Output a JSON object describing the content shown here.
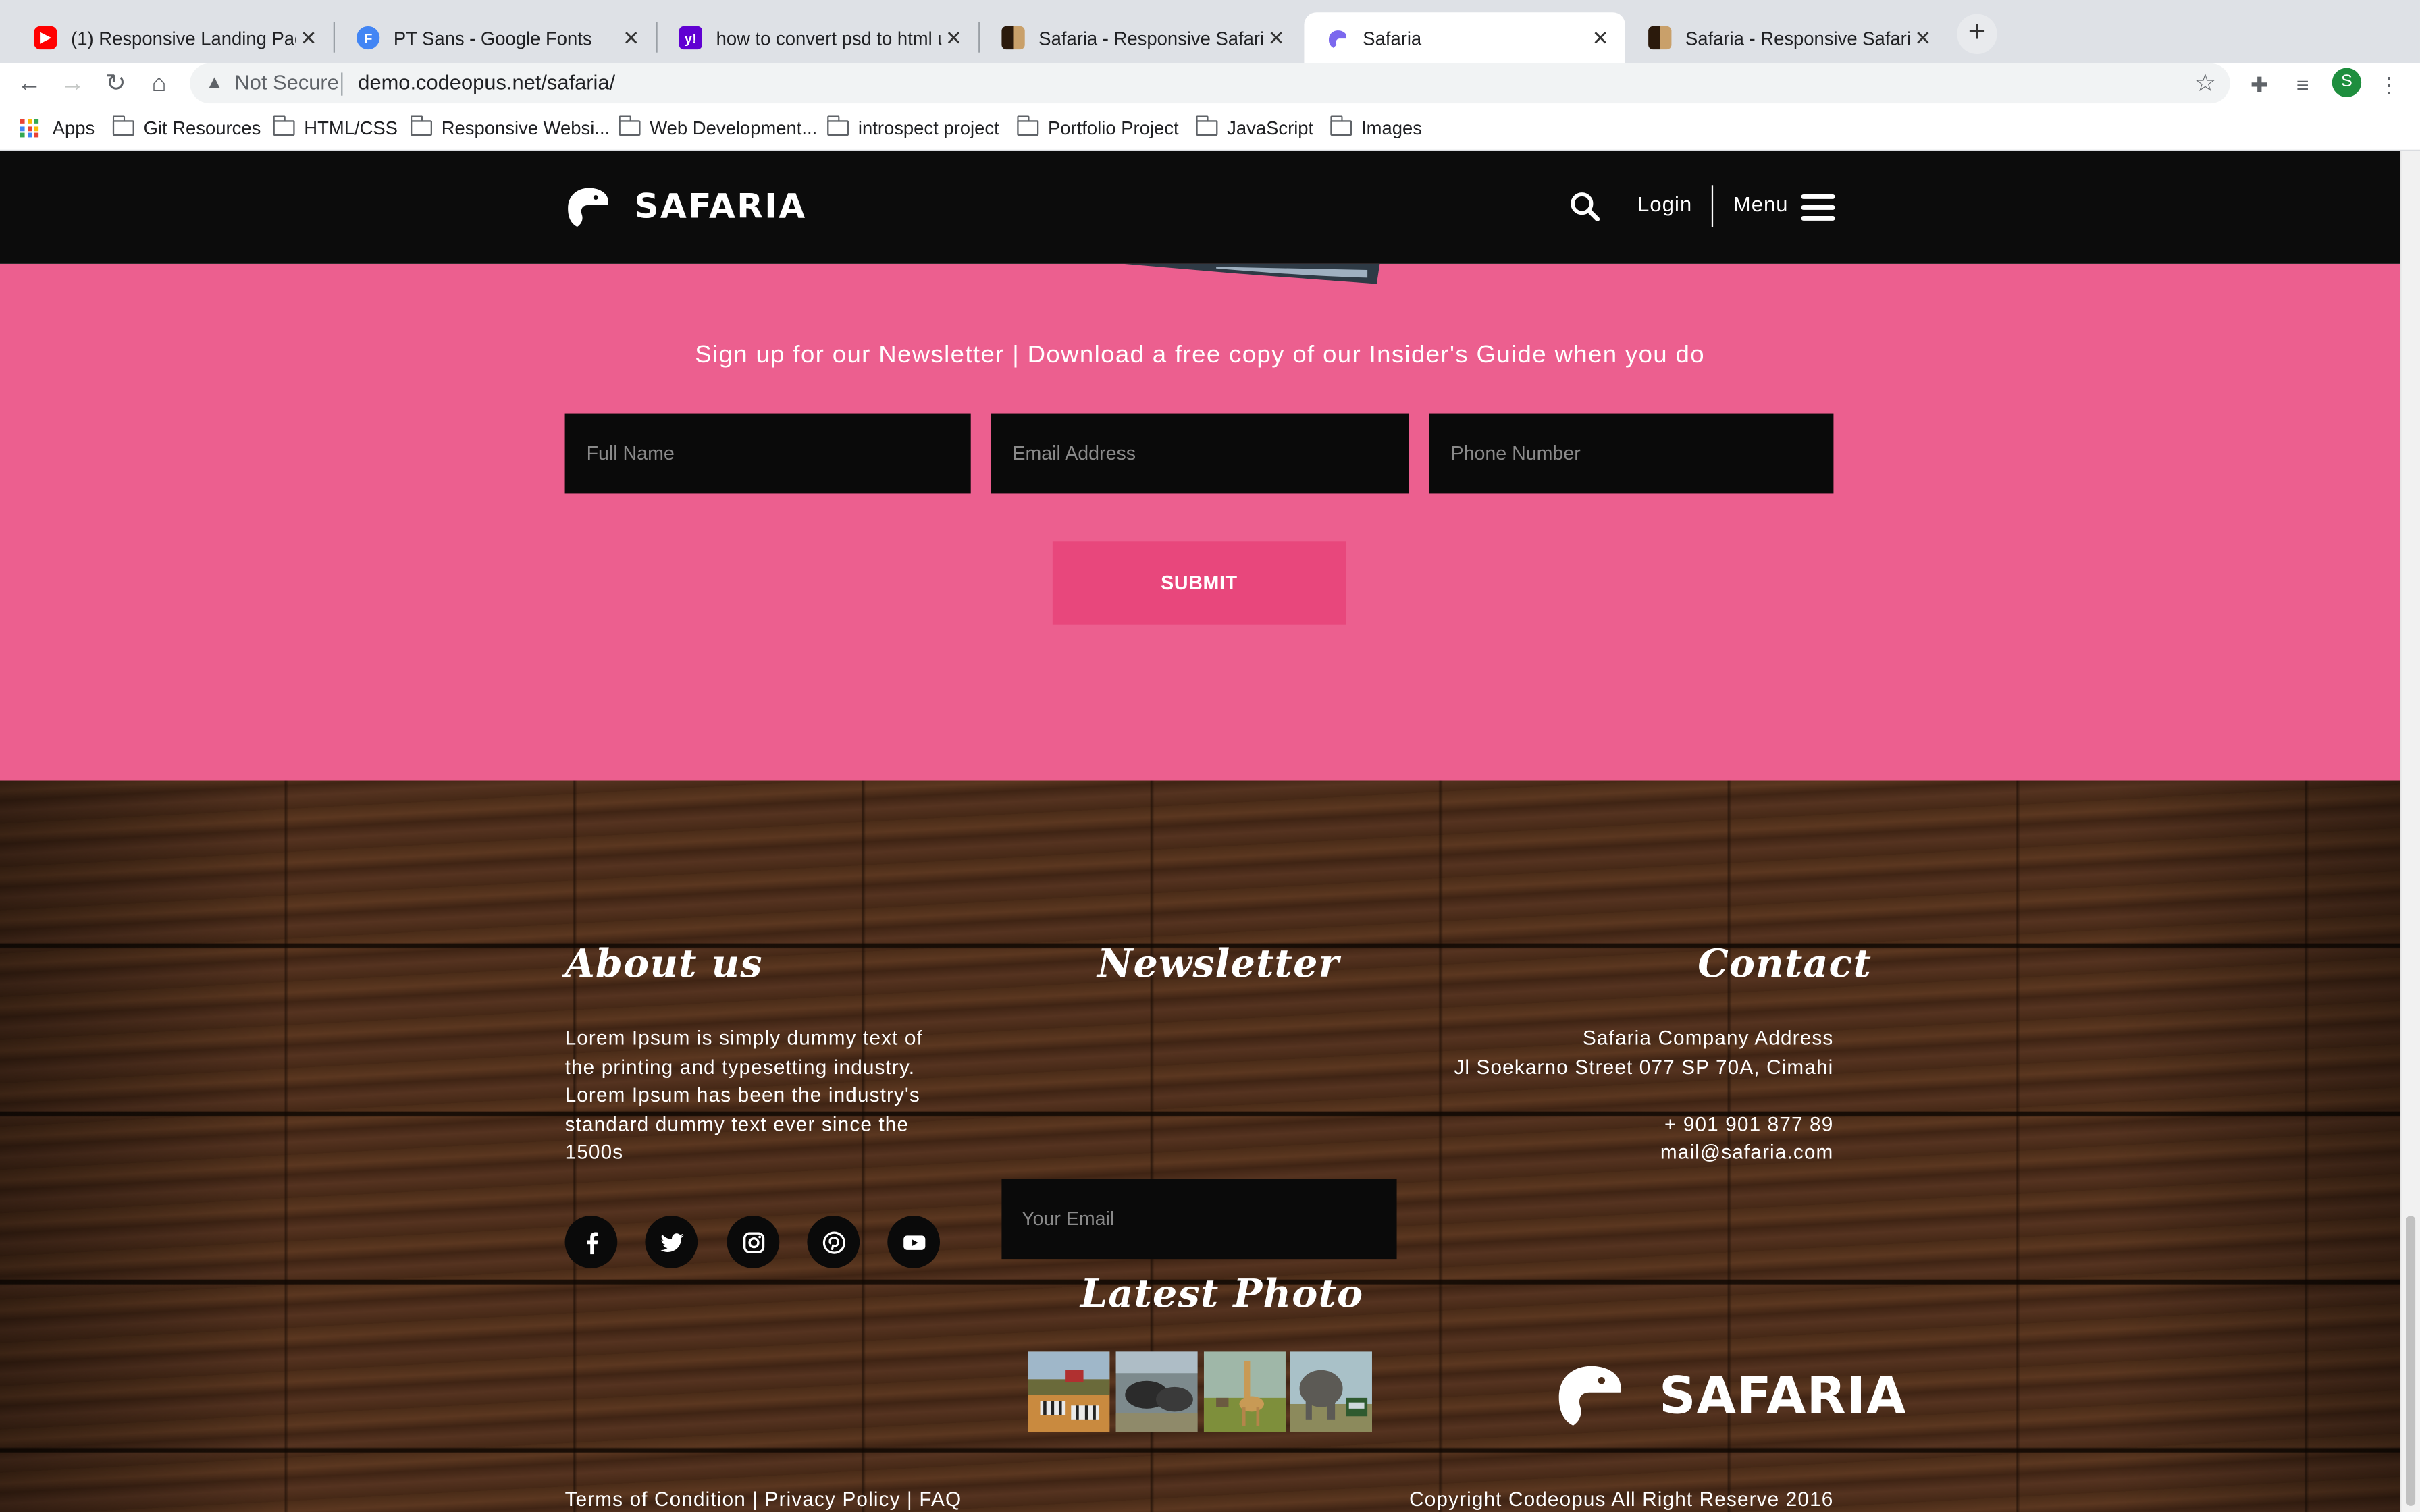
{
  "browser": {
    "tabs": [
      {
        "title": "(1) Responsive Landing Page U",
        "favicon": "youtube-icon",
        "color": "#ff0000"
      },
      {
        "title": "PT Sans - Google Fonts",
        "favicon": "google-fonts-icon",
        "color": "#4285f4"
      },
      {
        "title": "how to convert psd to html usin",
        "favicon": "yahoo-icon",
        "color": "#6001d2"
      },
      {
        "title": "Safaria - Responsive Safari Ten",
        "favicon": "safaria-thumb-icon",
        "color": "#5b3a1e"
      },
      {
        "title": "Safaria",
        "favicon": "safaria-icon",
        "color": "#7b68ee",
        "active": true
      },
      {
        "title": "Safaria - Responsive Safari Ten",
        "favicon": "safaria-thumb-icon",
        "color": "#5b3a1e"
      }
    ],
    "omnibox": {
      "security_label": "Not Secure",
      "url": "demo.codeopus.net/safaria/"
    },
    "profile_initial": "S",
    "bookmarks": [
      {
        "label": "Apps",
        "icon": "apps-grid-icon"
      },
      {
        "label": "Git Resources",
        "icon": "folder-icon"
      },
      {
        "label": "HTML/CSS",
        "icon": "folder-icon"
      },
      {
        "label": "Responsive Websi...",
        "icon": "folder-icon"
      },
      {
        "label": "Web Development...",
        "icon": "folder-icon"
      },
      {
        "label": "introspect project",
        "icon": "folder-icon"
      },
      {
        "label": "Portfolio Project",
        "icon": "folder-icon"
      },
      {
        "label": "JavaScript",
        "icon": "folder-icon"
      },
      {
        "label": "Images",
        "icon": "folder-icon"
      }
    ]
  },
  "header": {
    "logo_text": "SAFARIA",
    "login_label": "Login",
    "menu_label": "Menu"
  },
  "newsletter_section": {
    "heading": "Sign up for our Newsletter | Download a free copy of our Insider's Guide when you do",
    "full_name_placeholder": "Full Name",
    "email_placeholder": "Email Address",
    "phone_placeholder": "Phone Number",
    "submit_label": "SUBMIT",
    "accent_color": "#ec5f8f",
    "button_color": "#e8477c"
  },
  "footer": {
    "about": {
      "heading": "About us",
      "text": "Lorem Ipsum is simply dummy text of the printing and typesetting industry. Lorem Ipsum has been the industry's standard dummy text ever since the 1500s"
    },
    "social": [
      "facebook-icon",
      "twitter-icon",
      "instagram-icon",
      "pinterest-icon",
      "youtube-icon"
    ],
    "newsletter": {
      "heading": "Newsletter",
      "email_placeholder": "Your Email"
    },
    "latest_photo": {
      "heading": "Latest Photo",
      "photos": [
        "zebras-photo",
        "buffalo-photo",
        "giraffe-photo",
        "elephant-photo"
      ]
    },
    "contact": {
      "heading": "Contact",
      "address_title": "Safaria Company Address",
      "address_line": "Jl Soekarno Street 077 SP 70A, Cimahi",
      "phone": "+ 901 901 877 89",
      "email": "mail@safaria.com"
    },
    "logo_text": "SAFARIA",
    "links": {
      "terms": "Terms of Condition",
      "privacy": "Privacy Policy",
      "faq": "FAQ",
      "separator": "|"
    },
    "copyright": "Copyright Codeopus All Right Reserve 2016"
  }
}
